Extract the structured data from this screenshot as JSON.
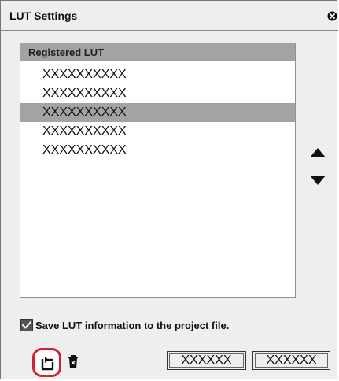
{
  "window": {
    "title": "LUT Settings",
    "close_icon": "close-circle-icon"
  },
  "registered_lut": {
    "header": "Registered LUT",
    "items": [
      {
        "label": "XXXXXXXXXX",
        "selected": false
      },
      {
        "label": "XXXXXXXXXX",
        "selected": false
      },
      {
        "label": "XXXXXXXXXX",
        "selected": true
      },
      {
        "label": "XXXXXXXXXX",
        "selected": false
      },
      {
        "label": "XXXXXXXXXX",
        "selected": false
      }
    ]
  },
  "reorder": {
    "up_icon": "triangle-up-icon",
    "down_icon": "triangle-down-icon"
  },
  "options": {
    "save_checkbox_label": "Save LUT information to the project file.",
    "save_checked": true
  },
  "toolbar": {
    "export_icon": "export-icon",
    "delete_icon": "trash-icon",
    "highlight_color": "#d0232f"
  },
  "buttons": {
    "button_1_label": "XXXXXX",
    "button_2_label": "XXXXXX"
  }
}
